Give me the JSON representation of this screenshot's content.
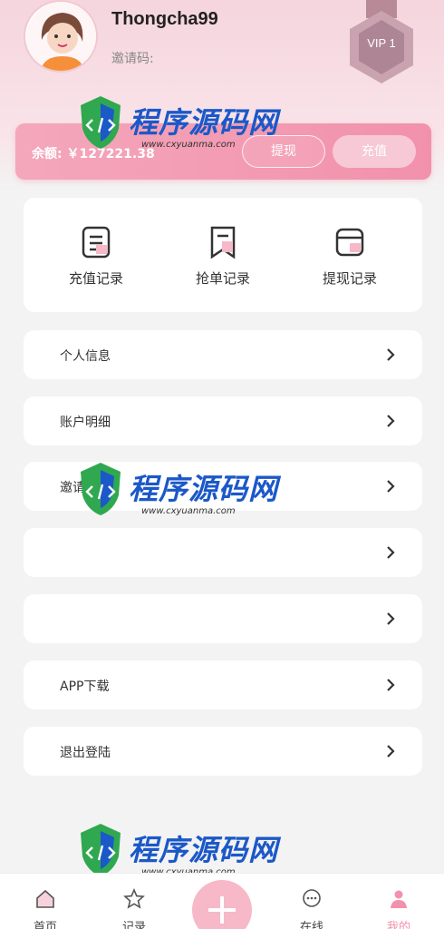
{
  "profile": {
    "username": "Thongcha99",
    "invite_label": "邀请码:",
    "vip_label": "VIP 1"
  },
  "balance_card": {
    "balance_text": "余额: ￥127221.38",
    "withdraw_label": "提现",
    "recharge_label": "充值"
  },
  "records": [
    {
      "label": "充值记录",
      "icon": "document-icon"
    },
    {
      "label": "抢单记录",
      "icon": "bookmark-icon"
    },
    {
      "label": "提现记录",
      "icon": "wallet-icon"
    }
  ],
  "menu": [
    {
      "label": "个人信息"
    },
    {
      "label": "账户明细"
    },
    {
      "label": "邀请"
    },
    {
      "label": ""
    },
    {
      "label": ""
    },
    {
      "label": "APP下载"
    },
    {
      "label": "退出登陆"
    }
  ],
  "watermark": {
    "title": "程序源码网",
    "url": "www.cxyuanma.com"
  },
  "tabs": [
    {
      "label": "首页",
      "icon": "home-icon"
    },
    {
      "label": "记录",
      "icon": "star-icon"
    },
    {
      "label": "在线",
      "icon": "chat-icon"
    },
    {
      "label": "我的",
      "icon": "user-icon"
    }
  ],
  "colors": {
    "accent": "#f291ab",
    "header": "#f6d5dd",
    "watermark_blue": "#1b58c8"
  }
}
